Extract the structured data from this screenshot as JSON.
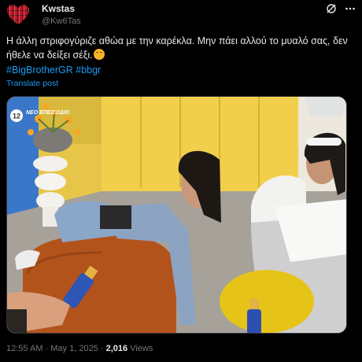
{
  "author": {
    "display_name": "Kwstas",
    "handle": "@Kw6Tas",
    "avatar_icon": "heart-icon",
    "avatar_color": "#c8102e"
  },
  "header_icons": [
    "grok-icon",
    "more-icon"
  ],
  "tweet": {
    "text": "Η άλλη στριφογύριζε αθώα με την καρέκλα. Μην πάει αλλού το μυαλό σας, δεν ήθελε να δείξει σέξι.",
    "emoji": "upside-down-face-emoji",
    "hashtags": [
      "#BigBrotherGR",
      "#bbgr"
    ],
    "translate_label": "Translate post"
  },
  "media": {
    "badge_number": "12",
    "badge_text": "ΝΕΟ ΕΠΕΙΣΟΔΙΟ"
  },
  "meta": {
    "time": "12:55 AM",
    "date": "May 1, 2025",
    "separator": " · ",
    "views_count": "2,016",
    "views_label": "Views"
  },
  "colors": {
    "background": "#000000",
    "text": "#e7e9ea",
    "secondary": "#71767b",
    "link": "#1d9bf0"
  }
}
